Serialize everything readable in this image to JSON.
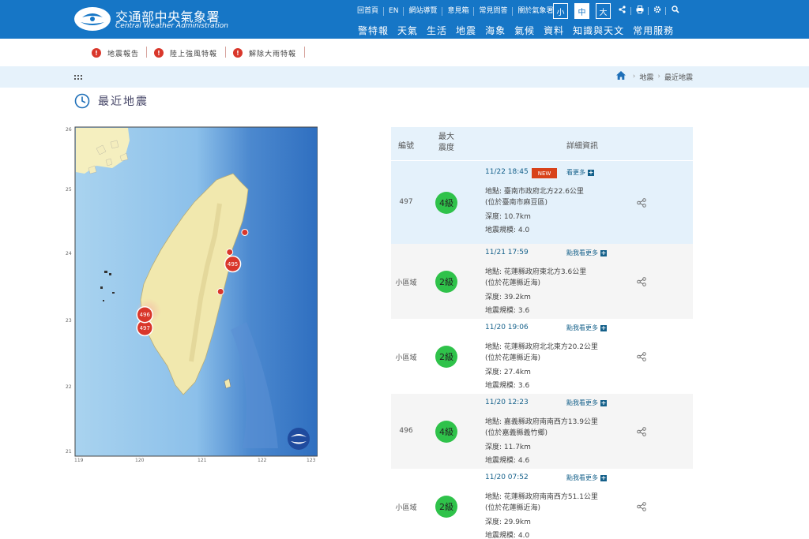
{
  "header": {
    "title": "交通部中央氣象署",
    "subtitle": "Central Weather Administration",
    "top_links": [
      "回首頁",
      "EN",
      "網站導覽",
      "意見箱",
      "常見問答",
      "關於氣象署"
    ],
    "font_sizes": [
      "小",
      "中",
      "大"
    ],
    "active_font_size": "中",
    "icons": [
      "share-icon",
      "print-icon",
      "gear-icon",
      "search-icon"
    ],
    "nav": [
      "警特報",
      "天氣",
      "生活",
      "地震",
      "海象",
      "氣候",
      "資料",
      "知識與天文",
      "常用服務"
    ],
    "color": "#1676c6"
  },
  "alerts": [
    {
      "icon": "!",
      "label": "地震報告"
    },
    {
      "icon": "!",
      "label": "陸上強風特報"
    },
    {
      "icon": "!",
      "label": "解除大雨特報"
    }
  ],
  "breadcrumb": [
    "地震",
    "最近地震"
  ],
  "page": {
    "title": "最近地震"
  },
  "map": {
    "lat_labels": [
      "26",
      "25",
      "24",
      "23",
      "22",
      "21"
    ],
    "lon_labels": [
      "119",
      "120",
      "121",
      "122",
      "123"
    ],
    "markers": [
      {
        "id": "497",
        "lon": 120.15,
        "lat": 22.95,
        "large": true
      },
      {
        "id": "496",
        "lon": 120.15,
        "lat": 23.15,
        "large": true
      },
      {
        "id": "495",
        "lon": 121.6,
        "lat": 23.92,
        "large": true
      },
      {
        "id": "",
        "lon": 121.8,
        "lat": 24.4,
        "large": false
      },
      {
        "id": "",
        "lon": 121.55,
        "lat": 24.1,
        "large": false
      },
      {
        "id": "",
        "lon": 121.4,
        "lat": 23.5,
        "large": false
      }
    ]
  },
  "table": {
    "headers": {
      "id": "編號",
      "intensity": "最大\n震度",
      "detail": "詳細資訊"
    },
    "rows": [
      {
        "id": "497",
        "intensity": "4級",
        "time": "11/22 18:45",
        "new": "NEW",
        "more": "看更多",
        "location": "地點: 臺南市政府北方22.6公里",
        "sub": "(位於臺南市麻豆區)",
        "depth": "深度: 10.7km",
        "magnitude": "地震規模: 4.0",
        "style": "hl"
      },
      {
        "id": "小區域",
        "intensity": "2級",
        "time": "11/21 17:59",
        "new": "",
        "more": "點我看更多",
        "location": "地點: 花蓮縣政府東北方3.6公里",
        "sub": "(位於花蓮縣近海)",
        "depth": "深度: 39.2km",
        "magnitude": "地震規模: 3.6",
        "style": "alt"
      },
      {
        "id": "小區域",
        "intensity": "2級",
        "time": "11/20 19:06",
        "new": "",
        "more": "點我看更多",
        "location": "地點: 花蓮縣政府北北東方20.2公里",
        "sub": "(位於花蓮縣近海)",
        "depth": "深度: 27.4km",
        "magnitude": "地震規模: 3.6",
        "style": "plain"
      },
      {
        "id": "496",
        "intensity": "4級",
        "time": "11/20 12:23",
        "new": "",
        "more": "點我看更多",
        "location": "地點: 嘉義縣政府南南西方13.9公里",
        "sub": "(位於嘉義縣義竹鄉)",
        "depth": "深度: 11.7km",
        "magnitude": "地震規模: 4.6",
        "style": "alt"
      },
      {
        "id": "小區域",
        "intensity": "2級",
        "time": "11/20 07:52",
        "new": "",
        "more": "點我看更多",
        "location": "地點: 花蓮縣政府南南西方51.1公里",
        "sub": "(位於花蓮縣近海)",
        "depth": "深度: 29.9km",
        "magnitude": "地震規模: 4.0",
        "style": "plain"
      }
    ]
  }
}
